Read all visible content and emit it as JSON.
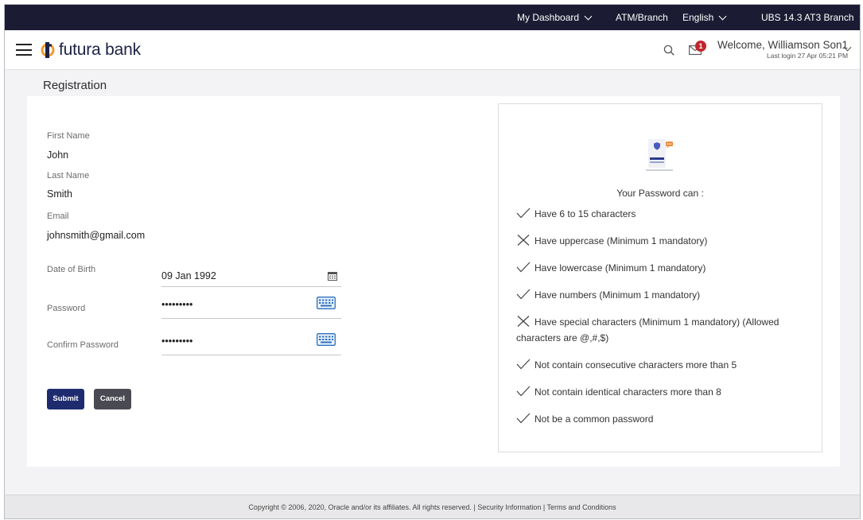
{
  "topbar": {
    "dashboard": "My Dashboard",
    "atm": "ATM/Branch",
    "language": "English",
    "branch": "UBS 14.3 AT3 Branch"
  },
  "header": {
    "logo_text": "futura bank",
    "notification_count": "1",
    "welcome": "Welcome, Williamson Son1",
    "last_login": "Last login 27 Apr 05:21 PM"
  },
  "page": {
    "title": "Registration"
  },
  "form": {
    "first_name_label": "First Name",
    "first_name": "John",
    "last_name_label": "Last Name",
    "last_name": "Smith",
    "email_label": "Email",
    "email": "johnsmith@gmail.com",
    "dob_label": "Date of Birth",
    "dob": "09 Jan 1992",
    "password_label": "Password",
    "password": "•••••••••",
    "confirm_label": "Confirm Password",
    "confirm": "•••••••••",
    "submit": "Submit",
    "cancel": "Cancel"
  },
  "rules": {
    "title": "Your Password can :",
    "items": [
      {
        "text": "Have 6 to 15 characters",
        "status": "check"
      },
      {
        "text": "Have uppercase (Minimum 1 mandatory)",
        "status": "cross"
      },
      {
        "text": "Have lowercase (Minimum 1 mandatory)",
        "status": "check"
      },
      {
        "text": "Have numbers (Minimum 1 mandatory)",
        "status": "check"
      },
      {
        "text": "Have special characters (Minimum 1 mandatory) (Allowed characters are @,#,$)",
        "status": "cross"
      },
      {
        "text": "Not contain consecutive characters more than 5",
        "status": "check"
      },
      {
        "text": "Not contain identical characters more than 8",
        "status": "check"
      },
      {
        "text": "Not be a common password",
        "status": "check"
      }
    ]
  },
  "footer": {
    "text": "Copyright © 2006, 2020, Oracle and/or its affiliates. All rights reserved. | Security Information | Terms and Conditions"
  },
  "colors": {
    "topbar": "#1b1c33",
    "submit": "#1e2b6e",
    "cancel": "#4a4a52",
    "badge": "#c0272d",
    "brand_orange": "#f39a2e"
  }
}
